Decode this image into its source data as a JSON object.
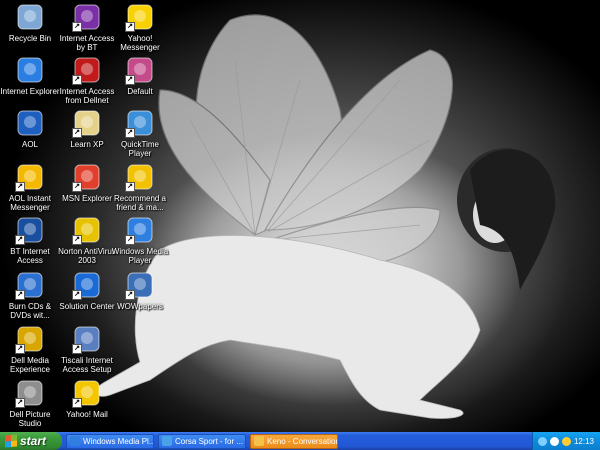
{
  "desktop": {
    "icons": [
      {
        "label": "Recycle Bin",
        "icon": "recycle-bin-icon",
        "color": "#7fa7d6"
      },
      {
        "label": "Internet Explorer",
        "icon": "internet-explorer-icon",
        "color": "#2a7de1"
      },
      {
        "label": "AOL",
        "icon": "aol-icon",
        "color": "#1e5fbf"
      },
      {
        "label": "AOL Instant Messenger",
        "icon": "aim-running-man-icon",
        "color": "#f5b800"
      },
      {
        "label": "BT Internet Access",
        "icon": "dell-logo-icon",
        "color": "#1a4fa0"
      },
      {
        "label": "Burn CDs & DVDs wit...",
        "icon": "burn-cd-icon",
        "color": "#2b6fd1"
      },
      {
        "label": "Dell Media Experience",
        "icon": "dell-media-icon",
        "color": "#d9a600"
      },
      {
        "label": "Dell Picture Studio",
        "icon": "dell-picture-studio-icon",
        "color": "#8e8e8e"
      },
      {
        "label": "Internet Access by BT",
        "icon": "bt-globe-icon",
        "color": "#7b2fa6"
      },
      {
        "label": "Internet Access from Dellnet",
        "icon": "dellnet-icon",
        "color": "#c01a1a"
      },
      {
        "label": "Learn XP",
        "icon": "learn-xp-icon",
        "color": "#e5d28a"
      },
      {
        "label": "MSN Explorer",
        "icon": "msn-butterfly-icon",
        "color": "#e0402b"
      },
      {
        "label": "Norton AntiVirus 2003",
        "icon": "norton-antivirus-icon",
        "color": "#e6c200"
      },
      {
        "label": "Solution Center",
        "icon": "dell-solution-center-icon",
        "color": "#1a6ad6"
      },
      {
        "label": "Tiscali Internet Access Setup",
        "icon": "tiscali-icon",
        "color": "#5a7fc0"
      },
      {
        "label": "Yahoo! Mail",
        "icon": "yahoo-mail-icon",
        "color": "#f3c600"
      },
      {
        "label": "Yahoo! Messenger",
        "icon": "yahoo-smiley-icon",
        "color": "#f8d200"
      },
      {
        "label": "Default",
        "icon": "default-media-icon",
        "color": "#c44a8a"
      },
      {
        "label": "QuickTime Player",
        "icon": "quicktime-icon",
        "color": "#3b8fd8"
      },
      {
        "label": "Recommend a friend & ma...",
        "icon": "recommend-friend-icon",
        "color": "#f2c200"
      },
      {
        "label": "Windows Media Player",
        "icon": "windows-media-player-icon",
        "color": "#2e7fe0"
      },
      {
        "label": "WOWpapers",
        "icon": "wowpapers-icon",
        "color": "#3a6fb8"
      }
    ]
  },
  "taskbar": {
    "start_label": "start",
    "tasks": [
      {
        "label": "Windows Media Pl...",
        "color": "#2e7fe0",
        "active": false
      },
      {
        "label": "Corsa Sport - for ...",
        "color": "#4aa3e8",
        "active": false
      },
      {
        "label": "Keno - Conversation",
        "color": "#f4c24a",
        "active": true
      }
    ],
    "clock": "12:13"
  }
}
